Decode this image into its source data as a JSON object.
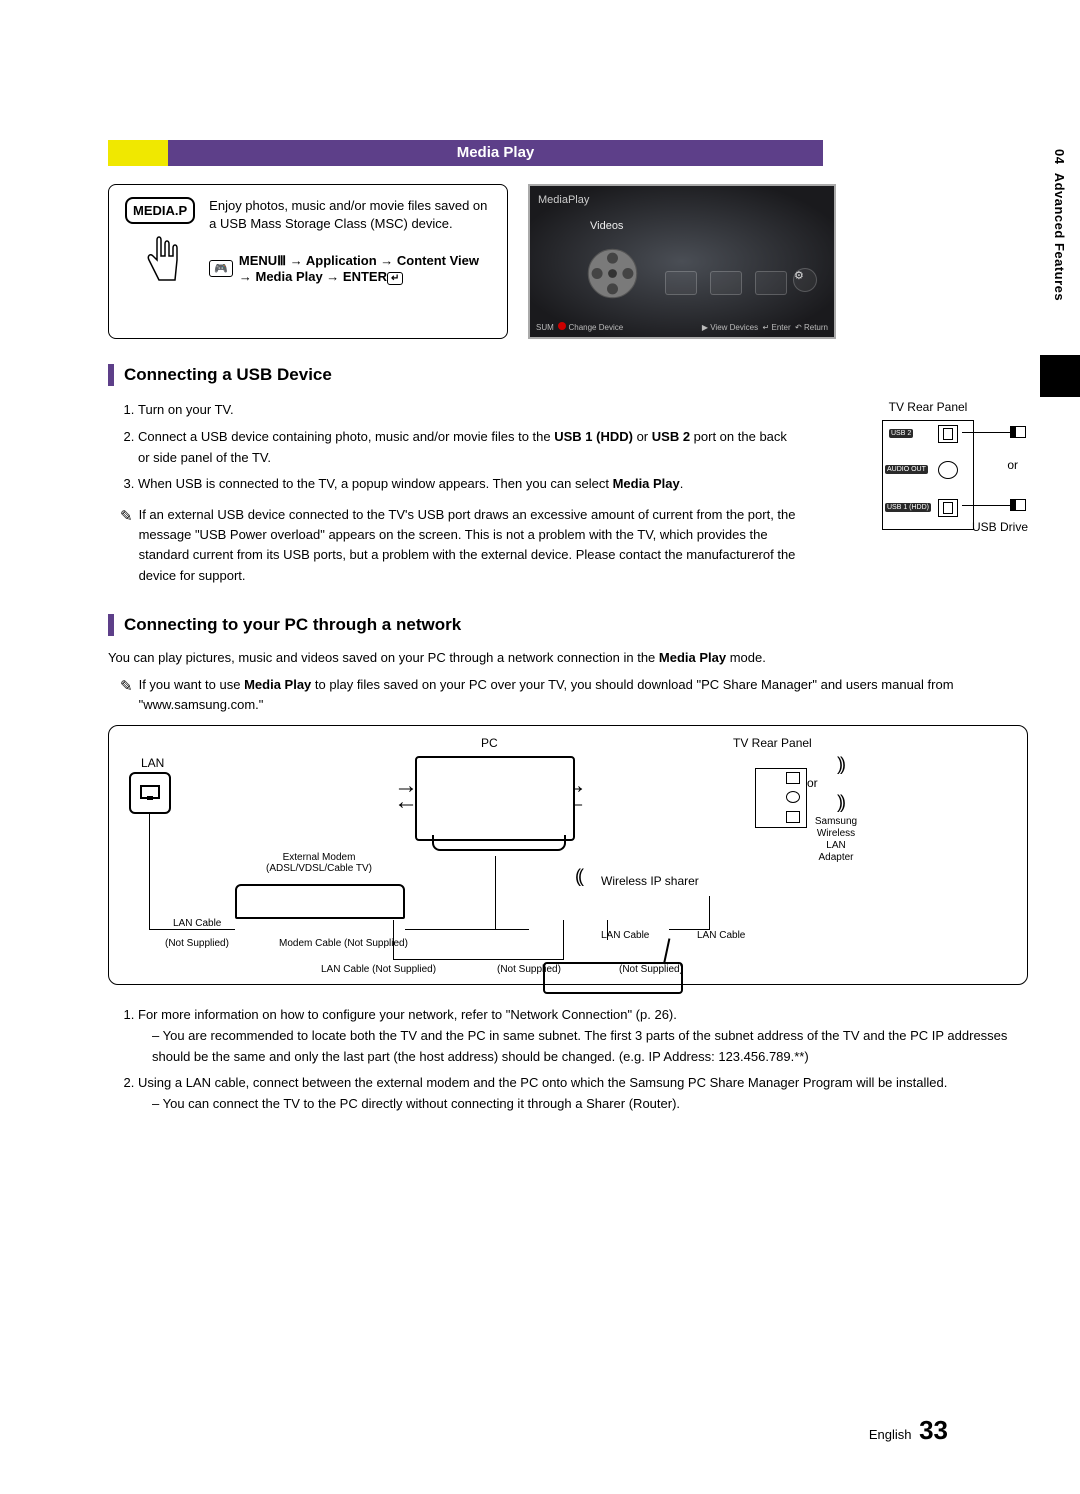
{
  "side_tab": {
    "num": "04",
    "label": "Advanced Features"
  },
  "header": {
    "title": "Media Play"
  },
  "intro": {
    "mediap_label": "MEDIA.P",
    "text": "Enjoy photos, music and/or movie files saved on a USB Mass Storage Class (MSC) device.",
    "menu_prefix": "MENU",
    "menu_path": " → Application → Content View → Media Play → ENTER"
  },
  "tv": {
    "mp": "MediaPlay",
    "videos": "Videos",
    "sum": "SUM",
    "change": "Change Device",
    "view": "View Devices",
    "enter": "Enter",
    "return": "Return"
  },
  "sec1": {
    "title": "Connecting a USB Device",
    "li1": "Turn on your TV.",
    "li2a": "Connect a USB device containing photo, music and/or movie files to the ",
    "li2b1": "USB 1 (HDD)",
    "li2b2": " or ",
    "li2b3": "USB 2",
    "li2c": " port on the back or side panel of the TV.",
    "li3a": "When USB is connected to the TV, a popup window appears. Then you can select ",
    "li3b": "Media Play",
    "li3c": ".",
    "note": "If an external USB device connected to the TV's USB port draws an excessive amount of current from the port, the message \"USB Power overload\" appears on the screen. This is not a problem with the TV, which provides the standard current from its USB ports, but a problem with the external device. Please contact the manufacturerof the device for support.",
    "fig_title": "TV Rear Panel",
    "port_usb2": "USB 2",
    "port_audio": "AUDIO OUT",
    "port_usb1": "USB 1 (HDD)",
    "or": "or",
    "drive": "USB Drive"
  },
  "sec2": {
    "title": "Connecting to your PC through a network",
    "intro_a": "You can play pictures, music and videos saved on your PC through a network connection in the ",
    "intro_b": "Media Play",
    "intro_c": " mode.",
    "note_a": "If you want to use ",
    "note_b": "Media Play",
    "note_c": " to play files saved on your PC over your TV, you should download \"PC Share Manager\" and users manual from \"www.samsung.com.\"",
    "li1": "For more information on how to configure your network, refer to \"Network Connection\" (p. 26).",
    "li1s1": "You are recommended to locate both the TV and the PC in same subnet. The first 3 parts of the subnet address of the TV and the PC IP addresses should be the same and only the last part (the host address) should be changed. (e.g. IP Address: 123.456.789.**)",
    "li2": "Using a LAN cable, connect between the external modem and the PC onto which the Samsung PC Share Manager Program will be installed.",
    "li2s1": "You can connect the TV to the PC directly without connecting it through a Sharer (Router)."
  },
  "fig2": {
    "lan": "LAN",
    "pc": "PC",
    "rear": "TV Rear Panel",
    "modem1": "External Modem",
    "modem2": "(ADSL/VDSL/Cable TV)",
    "router": "Wireless IP sharer",
    "adapter1": "Samsung",
    "adapter2": "Wireless",
    "adapter3": "LAN",
    "adapter4": "Adapter",
    "or": "or",
    "lan_cable": "LAN Cable",
    "ns": "(Not Supplied)",
    "modem_cable": "Modem Cable (Not Supplied)",
    "lan_cable_ns": "LAN Cable (Not Supplied)"
  },
  "footer": {
    "lang": "English",
    "page": "33"
  }
}
